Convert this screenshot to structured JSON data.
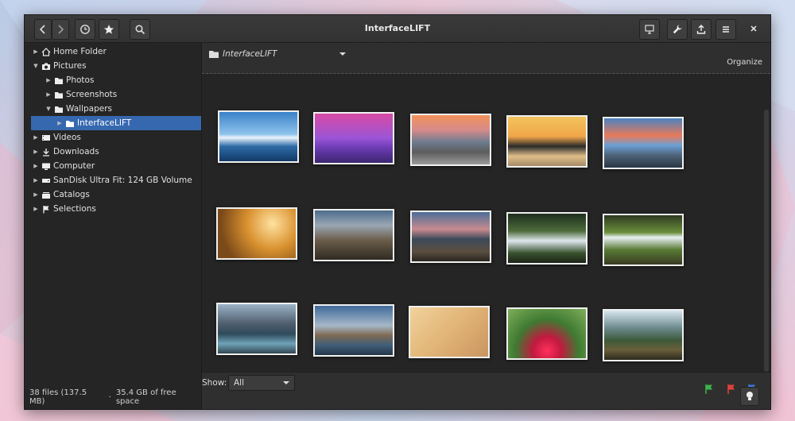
{
  "window": {
    "title": "InterfaceLIFT"
  },
  "sidebar": {
    "items": [
      {
        "label": "Home Folder",
        "icon": "home-icon",
        "expanded": false
      },
      {
        "label": "Pictures",
        "icon": "camera-icon",
        "expanded": true
      },
      {
        "label": "Photos",
        "icon": "folder-icon",
        "expanded": false
      },
      {
        "label": "Screenshots",
        "icon": "folder-icon",
        "expanded": false
      },
      {
        "label": "Wallpapers",
        "icon": "folder-icon",
        "expanded": true
      },
      {
        "label": "InterfaceLIFT",
        "icon": "folder-icon",
        "expanded": false,
        "selected": true
      },
      {
        "label": "Videos",
        "icon": "video-icon",
        "expanded": false
      },
      {
        "label": "Downloads",
        "icon": "download-icon",
        "expanded": false
      },
      {
        "label": "Computer",
        "icon": "computer-icon",
        "expanded": false
      },
      {
        "label": "SanDisk Ultra Fit: 124 GB Volume",
        "icon": "drive-icon",
        "expanded": false
      },
      {
        "label": "Catalogs",
        "icon": "catalog-icon",
        "expanded": false
      },
      {
        "label": "Selections",
        "icon": "flag-icon",
        "expanded": false
      }
    ]
  },
  "status": {
    "files": "38 files (137.5 MB)",
    "separator": "·",
    "free": "35.4 GB of free space"
  },
  "location": {
    "path": "InterfaceLIFT",
    "organize": "Organize"
  },
  "filter": {
    "show_label": "Show:",
    "show_value": "All"
  },
  "colors": {
    "accent": "#3668b0",
    "flag_green": "#3bb34a",
    "flag_red": "#e0403a",
    "flag_blue": "#3a79e0"
  }
}
